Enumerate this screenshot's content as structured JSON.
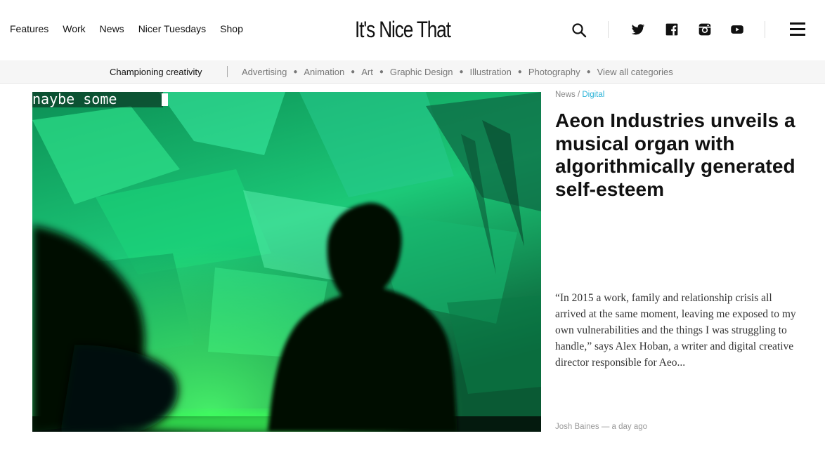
{
  "nav": {
    "items": [
      "Features",
      "Work",
      "News",
      "Nicer Tuesdays",
      "Shop"
    ],
    "logo": "It's Nice That"
  },
  "icons": {
    "search": "search-icon",
    "social": [
      "twitter-icon",
      "facebook-icon",
      "instagram-icon",
      "youtube-icon"
    ],
    "menu": "hamburger-menu-icon"
  },
  "catbar": {
    "tagline": "Championing creativity",
    "categories": [
      "Advertising",
      "Animation",
      "Art",
      "Graphic Design",
      "Illustration",
      "Photography",
      "View all categories"
    ]
  },
  "hero": {
    "overlay_text": "naybe some"
  },
  "article": {
    "section": "News",
    "separator": "/",
    "category": "Digital",
    "headline": "Aeon Industries unveils a musical organ with algorithmically generated self-esteem",
    "excerpt": "“In 2015 a work, family and relationship crisis all arrived at the same moment, leaving me exposed to my own vulnerabilities and the things I was struggling to handle,” says Alex Hoban, a writer and digital creative director responsible for Aeo...",
    "author": "Josh Baines",
    "time": "— a day ago"
  },
  "colors": {
    "accent": "#2bb3d8",
    "hero_green": "#1fd37a"
  }
}
